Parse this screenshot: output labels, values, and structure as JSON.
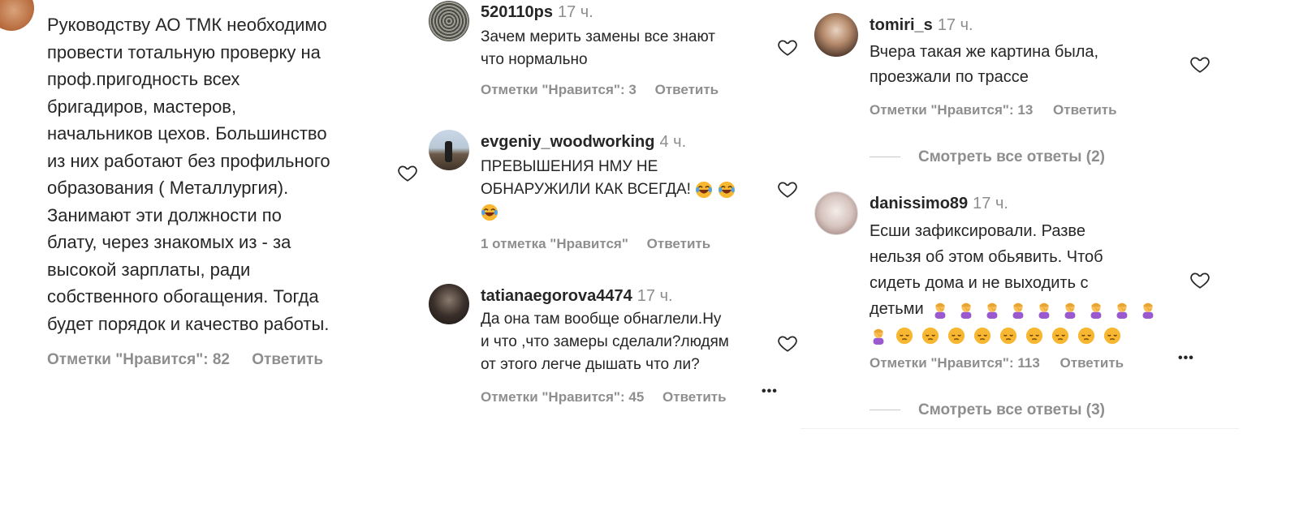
{
  "col1": {
    "comment": {
      "username": "",
      "text_lines": [
        "Руководству АО ТМК необходимо",
        "провести тотальную проверку на",
        "проф.пригодность всех",
        "бригадиров, мастеров,",
        "начальников цехов. Большинство",
        "из них работают без профильного",
        "образования ( Металлургия).",
        "Занимают эти должности по",
        "блату, через знакомых из - за",
        "высокой зарплаты, ради",
        "собственного обогащения. Тогда",
        "будет порядок и качество работы."
      ],
      "likes": "Отметки \"Нравится\": 82",
      "reply": "Ответить"
    }
  },
  "col2": {
    "c1": {
      "username": "520110ps",
      "time": "17 ч.",
      "text_lines": [
        "Зачем мерить замены все знают",
        "что нормально"
      ],
      "likes": "Отметки \"Нравится\": 3",
      "reply": "Ответить"
    },
    "c2": {
      "username": "evgeniy_woodworking",
      "time": "4 ч.",
      "text_line1": "ПРЕВЫШЕНИЯ НМУ НЕ",
      "text_line2": "ОБНАРУЖИЛИ КАК ВСЕГДА!",
      "likes": "1 отметка \"Нравится\"",
      "reply": "Ответить"
    },
    "c3": {
      "username": "tatianaegorova4474",
      "time": "17 ч.",
      "text_lines": [
        "Да она там вообще обнаглели.Ну",
        "и что ,что замеры сделали?людям",
        "от этого легче дышать что ли?"
      ],
      "likes": "Отметки \"Нравится\": 45",
      "reply": "Ответить",
      "more": "•••"
    }
  },
  "col3": {
    "c1": {
      "username": "tomiri_s",
      "time": "17 ч.",
      "text_lines": [
        "Вчера такая же картина была,",
        "проезжали по трассе"
      ],
      "likes": "Отметки \"Нравится\": 13",
      "reply": "Ответить",
      "view_all": "Смотреть все ответы (2)"
    },
    "c2": {
      "username": "danissimo89",
      "time": "17 ч.",
      "text_lines": [
        "Есши зафиксировали. Разве",
        "нельзя об этом обьявить. Чтоб",
        "сидеть дома и не выходить с"
      ],
      "text_last": "детьми",
      "likes": "Отметки \"Нравится\": 113",
      "reply": "Ответить",
      "more": "•••",
      "view_all": "Смотреть все ответы (3)"
    }
  },
  "icons": {
    "heart": "heart-outline-icon",
    "laugh_emoji": "face-with-tears-of-joy",
    "facepalm_emoji": "person-facepalming",
    "pensive_emoji": "pensive-face"
  }
}
